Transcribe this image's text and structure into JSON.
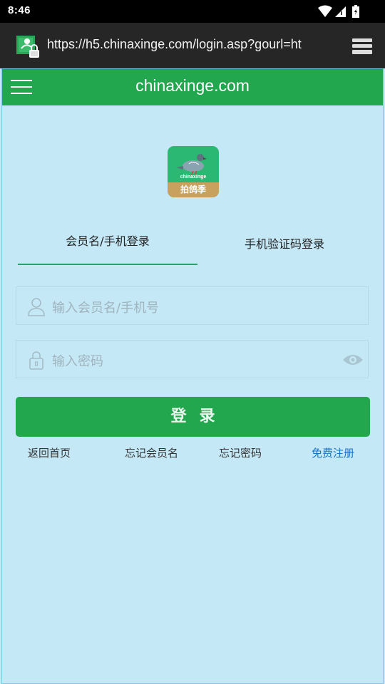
{
  "status_bar": {
    "time": "8:46",
    "icons": [
      "wifi-icon",
      "signal-icon",
      "battery-icon"
    ]
  },
  "browser": {
    "url": "https://h5.chinaxinge.com/login.asp?gourl=ht",
    "site_icon": "site-lock-icon",
    "tabs_icon": "tabs-stack-icon"
  },
  "app_bar": {
    "title": "chinaxinge.com",
    "menu_icon": "hamburger-menu-icon",
    "color": "#22a74e"
  },
  "logo": {
    "brand_text": "chinaxinge",
    "banner_text": "拍鸽季"
  },
  "tabs": [
    {
      "label": "会员名/手机登录",
      "active": true
    },
    {
      "label": "手机验证码登录",
      "active": false
    }
  ],
  "form": {
    "username_placeholder": "输入会员名/手机号",
    "password_placeholder": "输入密码",
    "login_label": "登录"
  },
  "links": {
    "home": "返回首页",
    "forgot_username": "忘记会员名",
    "forgot_password": "忘记密码",
    "register": "免费注册"
  },
  "colors": {
    "accent": "#22a74e",
    "page_bg": "#c5e8f7",
    "link": "#1a73c9"
  }
}
